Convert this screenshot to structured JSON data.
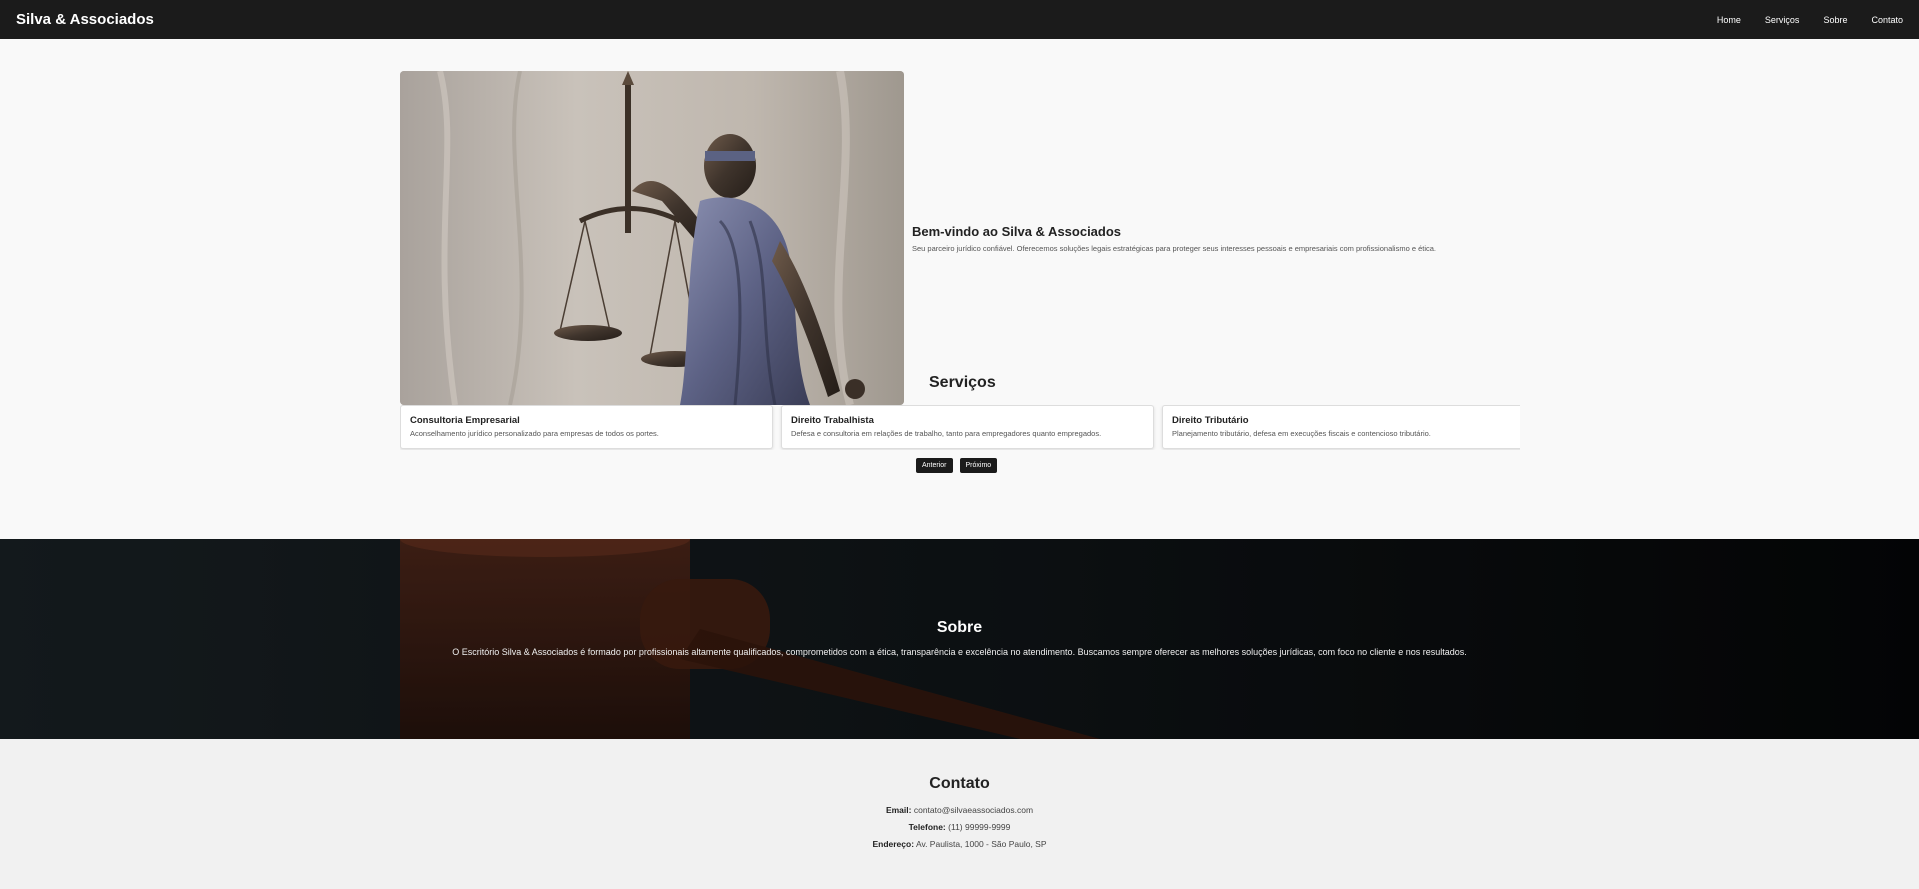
{
  "header": {
    "brand": "Silva & Associados",
    "nav": [
      "Home",
      "Serviços",
      "Sobre",
      "Contato"
    ]
  },
  "hero": {
    "image_icon": "lady-justice-statue-image",
    "title": "Bem-vindo ao Silva & Associados",
    "text": "Seu parceiro jurídico confiável. Oferecemos soluções legais estratégicas para proteger seus interesses pessoais e empresariais com profissionalismo e ética."
  },
  "services": {
    "title": "Serviços",
    "items": [
      {
        "title": "Consultoria Empresarial",
        "text": "Aconselhamento jurídico personalizado para empresas de todos os portes."
      },
      {
        "title": "Direito Trabalhista",
        "text": "Defesa e consultoria em relações de trabalho, tanto para empregadores quanto empregados."
      },
      {
        "title": "Direito Tributário",
        "text": "Planejamento tributário, defesa em execuções fiscais e contencioso tributário."
      }
    ],
    "prev_label": "Anterior",
    "next_label": "Próximo"
  },
  "about": {
    "background_icon": "gavel-image",
    "title": "Sobre",
    "text": "O Escritório Silva & Associados é formado por profissionais altamente qualificados, comprometidos com a ética, transparência e excelência no atendimento. Buscamos sempre oferecer as melhores soluções jurídicas, com foco no cliente e nos resultados."
  },
  "contact": {
    "title": "Contato",
    "email_label": "Email:",
    "email": "contato@silvaeassociados.com",
    "phone_label": "Telefone:",
    "phone": "(11) 99999-9999",
    "address_label": "Endereço:",
    "address": "Av. Paulista, 1000 - São Paulo, SP"
  },
  "colors": {
    "header_bg": "#1b1b1b",
    "page_bg": "#f9f9f9",
    "about_bg": "#0e1113",
    "contact_bg": "#f1f1f1"
  }
}
